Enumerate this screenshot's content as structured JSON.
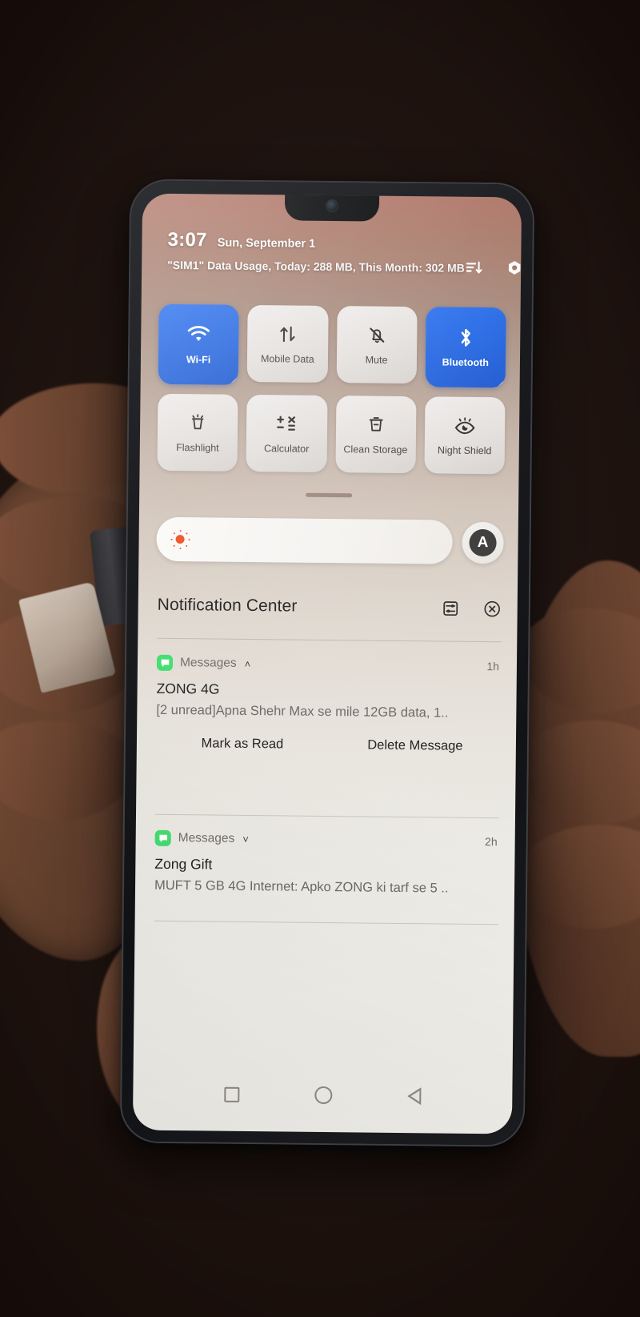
{
  "device": {
    "description": "Android phone held in hand showing quick settings and notification shade"
  },
  "status_bar": {
    "time": "3:07",
    "date": "Sun, September 1",
    "data_usage": "\"SIM1\" Data Usage, Today: 288 MB, This Month: 302 MB",
    "icons": [
      {
        "name": "sort-order-icon",
        "glyph": "sort"
      },
      {
        "name": "settings-gear-icon",
        "glyph": "gear"
      }
    ]
  },
  "quick_settings": {
    "tiles": [
      {
        "label": "Wi-Fi",
        "icon": "wifi-icon",
        "state": "on",
        "expandable": true
      },
      {
        "label": "Mobile Data",
        "icon": "mobile-data-icon",
        "state": "off",
        "expandable": false
      },
      {
        "label": "Mute",
        "icon": "bell-mute-icon",
        "state": "off",
        "expandable": false
      },
      {
        "label": "Bluetooth",
        "icon": "bluetooth-icon",
        "state": "on",
        "expandable": true
      },
      {
        "label": "Flashlight",
        "icon": "flashlight-icon",
        "state": "off",
        "expandable": false
      },
      {
        "label": "Calculator",
        "icon": "calculator-icon",
        "state": "off",
        "expandable": false
      },
      {
        "label": "Clean\nStorage",
        "icon": "clean-storage-icon",
        "state": "off",
        "expandable": false
      },
      {
        "label": "Night Shield",
        "icon": "night-shield-icon",
        "state": "off",
        "expandable": false
      }
    ],
    "tile_on_color": "#2566e0",
    "tile_off_color": "#e6e2df"
  },
  "brightness": {
    "icon": "brightness-sun-icon",
    "sun_color": "#f04b1e",
    "level_percent": 0,
    "auto_button_label": "A",
    "auto_button_name": "auto-brightness-button"
  },
  "notification_center": {
    "title": "Notification Center",
    "icons": [
      {
        "name": "notification-settings-icon"
      },
      {
        "name": "clear-all-notifications-icon"
      }
    ],
    "notifications": [
      {
        "app": "Messages",
        "app_icon_color": "#3ddc6c",
        "expanded": true,
        "chevron": "˄",
        "time": "1h",
        "title": "ZONG 4G",
        "body": "[2 unread]Apna Shehr Max se mile 12GB data, 1..",
        "actions": [
          "Mark as Read",
          "Delete Message"
        ]
      },
      {
        "app": "Messages",
        "app_icon_color": "#3ddc6c",
        "expanded": false,
        "chevron": "˅",
        "time": "2h",
        "title": "Zong Gift",
        "body": "MUFT 5 GB 4G Internet: Apko ZONG ki tarf se 5 ..",
        "actions": []
      }
    ]
  },
  "nav_bar": {
    "buttons": [
      {
        "name": "recents-button",
        "shape": "square"
      },
      {
        "name": "home-button",
        "shape": "circle"
      },
      {
        "name": "back-button",
        "shape": "triangle"
      }
    ]
  }
}
